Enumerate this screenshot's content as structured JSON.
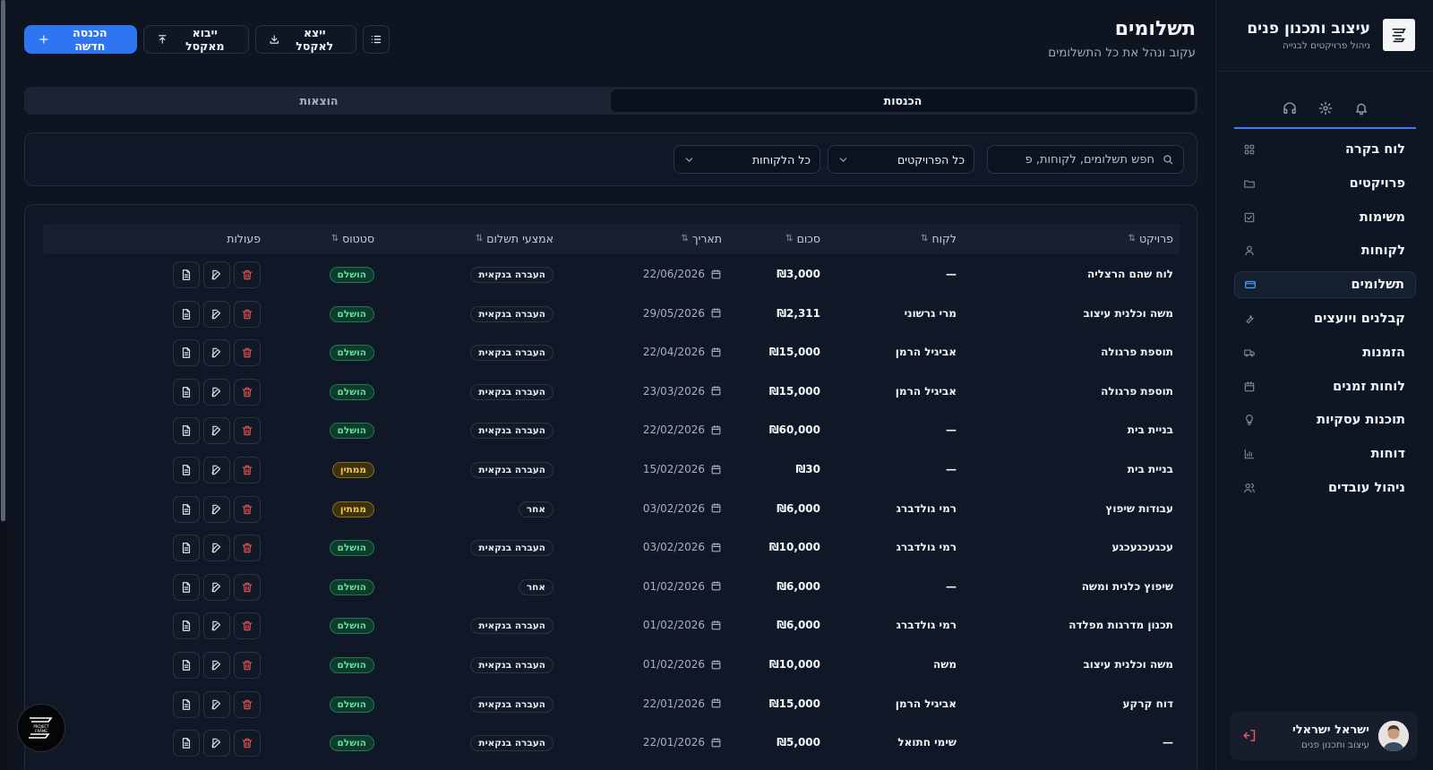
{
  "sidebar": {
    "brand_title": "עיצוב ותכנון פנים",
    "brand_sub": "ניהול פרויקטים לבנייה",
    "nav": [
      {
        "label": "לוח בקרה",
        "icon": "dashboard-icon"
      },
      {
        "label": "פרויקטים",
        "icon": "folder-icon"
      },
      {
        "label": "משימות",
        "icon": "checkbox-icon"
      },
      {
        "label": "לקוחות",
        "icon": "user-icon"
      },
      {
        "label": "תשלומים",
        "icon": "credit-card-icon",
        "active": true
      },
      {
        "label": "קבלנים ויועצים",
        "icon": "wrench-icon"
      },
      {
        "label": "הזמנות",
        "icon": "truck-icon"
      },
      {
        "label": "לוחות זמנים",
        "icon": "calendar-icon"
      },
      {
        "label": "תוכנות עסקיות",
        "icon": "lightbulb-icon"
      },
      {
        "label": "דוחות",
        "icon": "bar-chart-icon"
      },
      {
        "label": "ניהול עובדים",
        "icon": "users-icon"
      }
    ],
    "user": {
      "name": "ישראל ישראלי",
      "role": "עיצוב ותכנון פנים"
    }
  },
  "header": {
    "title": "תשלומים",
    "subtitle": "עקוב ונהל את כל התשלומים",
    "new_label": "הכנסה חדשה",
    "import_label": "ייבוא מאקסל",
    "export_label": "ייצא לאקסל"
  },
  "tabs": {
    "income": "הכנסות",
    "expenses": "הוצאות"
  },
  "filters": {
    "search_placeholder": "חפש תשלומים, לקוחות, פ",
    "projects": "כל הפרויקטים",
    "clients": "כל הלקוחות"
  },
  "table": {
    "headers": {
      "project": "פרויקט",
      "client": "לקוח",
      "amount": "סכום",
      "date": "תאריך",
      "method": "אמצעי תשלום",
      "status": "סטטוס",
      "actions": "פעולות"
    },
    "rows": [
      {
        "project": "לוח שהם הרצליה",
        "client": "—",
        "amount": "₪3,000",
        "date": "22/06/2026",
        "method": "העברה בנקאית",
        "status": "הושלם",
        "status_type": "done"
      },
      {
        "project": "משה וכלנית עיצוב",
        "client": "מרי גרשוני",
        "amount": "₪2,311",
        "date": "29/05/2026",
        "method": "העברה בנקאית",
        "status": "הושלם",
        "status_type": "done"
      },
      {
        "project": "תוספת פרגולה",
        "client": "אביגיל הרמן",
        "amount": "₪15,000",
        "date": "22/04/2026",
        "method": "העברה בנקאית",
        "status": "הושלם",
        "status_type": "done"
      },
      {
        "project": "תוספת פרגולה",
        "client": "אביגיל הרמן",
        "amount": "₪15,000",
        "date": "23/03/2026",
        "method": "העברה בנקאית",
        "status": "הושלם",
        "status_type": "done"
      },
      {
        "project": "בניית בית",
        "client": "—",
        "amount": "₪60,000",
        "date": "22/02/2026",
        "method": "העברה בנקאית",
        "status": "הושלם",
        "status_type": "done"
      },
      {
        "project": "בניית בית",
        "client": "—",
        "amount": "₪30",
        "date": "15/02/2026",
        "method": "העברה בנקאית",
        "status": "ממתין",
        "status_type": "pending"
      },
      {
        "project": "עבודות שיפוץ",
        "client": "רמי גולדברג",
        "amount": "₪6,000",
        "date": "03/02/2026",
        "method": "אחר",
        "status": "ממתין",
        "status_type": "pending"
      },
      {
        "project": "עכגעכגעכגע",
        "client": "רמי גולדברג",
        "amount": "₪10,000",
        "date": "03/02/2026",
        "method": "העברה בנקאית",
        "status": "הושלם",
        "status_type": "done"
      },
      {
        "project": "שיפוץ כלנית ומשה",
        "client": "—",
        "amount": "₪6,000",
        "date": "01/02/2026",
        "method": "אחר",
        "status": "הושלם",
        "status_type": "done"
      },
      {
        "project": "תכנון מדרגות מפלדה",
        "client": "רמי גולדברג",
        "amount": "₪6,000",
        "date": "01/02/2026",
        "method": "העברה בנקאית",
        "status": "הושלם",
        "status_type": "done"
      },
      {
        "project": "משה וכלנית עיצוב",
        "client": "משה",
        "amount": "₪10,000",
        "date": "01/02/2026",
        "method": "העברה בנקאית",
        "status": "הושלם",
        "status_type": "done"
      },
      {
        "project": "דוח קרקע",
        "client": "אביגיל הרמן",
        "amount": "₪15,000",
        "date": "22/01/2026",
        "method": "העברה בנקאית",
        "status": "הושלם",
        "status_type": "done"
      },
      {
        "project": "—",
        "client": "שימי חתואל",
        "amount": "₪5,000",
        "date": "22/01/2026",
        "method": "העברה בנקאית",
        "status": "הושלם",
        "status_type": "done"
      }
    ]
  },
  "fab": {
    "label_line1": "PROJECT",
    "label_line2": "FRAME"
  },
  "colors": {
    "accent": "#2f74f0",
    "done": "#5ee0a0",
    "pending": "#f5c64a",
    "danger": "#e55353"
  }
}
